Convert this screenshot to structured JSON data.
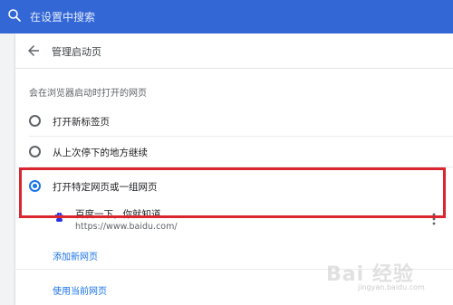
{
  "search": {
    "placeholder": "在设置中搜索",
    "icon": "search-icon"
  },
  "header": {
    "title": "管理启动页",
    "back_icon": "back-arrow-icon"
  },
  "section_label": "会在浏览器启动时打开的网页",
  "options": [
    {
      "label": "打开新标签页",
      "checked": false
    },
    {
      "label": "从上次停下的地方继续",
      "checked": false
    },
    {
      "label": "打开特定网页或一组网页",
      "checked": true
    }
  ],
  "site": {
    "name": "百度一下，你就知道",
    "url": "https://www.baidu.com/",
    "icon": "baidu-paw-icon"
  },
  "links": {
    "add": "添加新网页",
    "use_current": "使用当前网页"
  },
  "watermark": {
    "text": "Bai 经验",
    "sub": "jingyan.baidu.com"
  },
  "colors": {
    "topbar": "#3367d6",
    "accent": "#1a73e8",
    "highlight": "#d9262f"
  }
}
